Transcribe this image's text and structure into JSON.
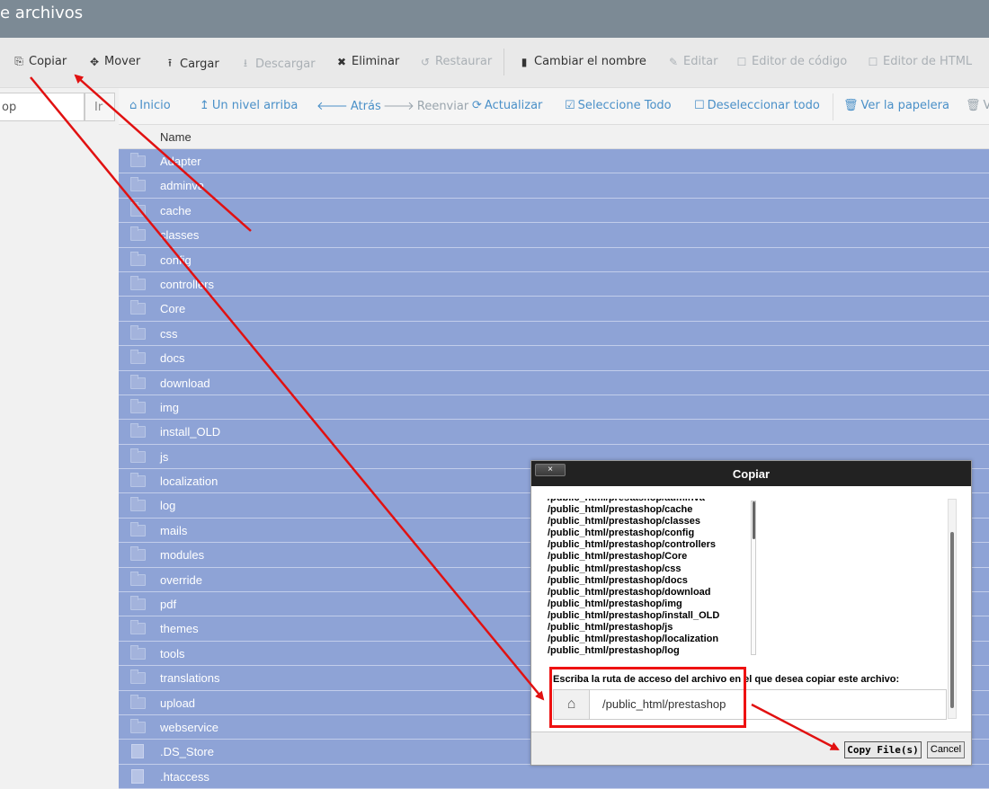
{
  "window": {
    "title": "e archivos"
  },
  "toolbar": {
    "items": [
      {
        "label": "Copiar",
        "icon": "copy-icon",
        "enabled": true
      },
      {
        "label": "Mover",
        "icon": "move-icon",
        "enabled": true
      },
      {
        "label": "Cargar",
        "icon": "upload-icon",
        "enabled": true
      },
      {
        "label": "Descargar",
        "icon": "download-icon",
        "enabled": false
      },
      {
        "label": "Eliminar",
        "icon": "delete-icon",
        "enabled": true
      },
      {
        "label": "Restaurar",
        "icon": "restore-icon",
        "enabled": false
      },
      {
        "label": "Cambiar el nombre",
        "icon": "file-icon",
        "enabled": true
      },
      {
        "label": "Editar",
        "icon": "pencil-icon",
        "enabled": false
      },
      {
        "label": "Editor de código",
        "icon": "edit-icon",
        "enabled": false
      },
      {
        "label": "Editor de HTML",
        "icon": "edit-icon",
        "enabled": false
      }
    ]
  },
  "left": {
    "path_value": "op",
    "go_label": "Ir"
  },
  "nav": {
    "items": [
      {
        "label": "Inicio",
        "icon": "home-icon",
        "enabled": true
      },
      {
        "label": "Un nivel arriba",
        "icon": "level-up-icon",
        "enabled": true
      },
      {
        "label": "Atrás",
        "icon": "arrow-left-icon",
        "enabled": true
      },
      {
        "label": "Reenviar",
        "icon": "arrow-right-icon",
        "enabled": false
      },
      {
        "label": "Actualizar",
        "icon": "refresh-icon",
        "enabled": true
      },
      {
        "label": "Seleccione Todo",
        "icon": "checkbox-checked-icon",
        "enabled": true
      },
      {
        "label": "Deseleccionar todo",
        "icon": "checkbox-empty-icon",
        "enabled": true
      },
      {
        "label": "Ver la papelera",
        "icon": "trash-icon",
        "enabled": true
      },
      {
        "label": "V",
        "icon": "trash-icon",
        "enabled": false
      }
    ]
  },
  "filelist": {
    "column_name": "Name",
    "rows": [
      {
        "name": "Adapter",
        "type": "folder"
      },
      {
        "name": "adminva",
        "type": "folder"
      },
      {
        "name": "cache",
        "type": "folder"
      },
      {
        "name": "classes",
        "type": "folder"
      },
      {
        "name": "config",
        "type": "folder"
      },
      {
        "name": "controllers",
        "type": "folder"
      },
      {
        "name": "Core",
        "type": "folder"
      },
      {
        "name": "css",
        "type": "folder"
      },
      {
        "name": "docs",
        "type": "folder"
      },
      {
        "name": "download",
        "type": "folder"
      },
      {
        "name": "img",
        "type": "folder"
      },
      {
        "name": "install_OLD",
        "type": "folder"
      },
      {
        "name": "js",
        "type": "folder"
      },
      {
        "name": "localization",
        "type": "folder"
      },
      {
        "name": "log",
        "type": "folder"
      },
      {
        "name": "mails",
        "type": "folder"
      },
      {
        "name": "modules",
        "type": "folder"
      },
      {
        "name": "override",
        "type": "folder"
      },
      {
        "name": "pdf",
        "type": "folder"
      },
      {
        "name": "themes",
        "type": "folder"
      },
      {
        "name": "tools",
        "type": "folder"
      },
      {
        "name": "translations",
        "type": "folder"
      },
      {
        "name": "upload",
        "type": "folder"
      },
      {
        "name": "webservice",
        "type": "folder"
      },
      {
        "name": ".DS_Store",
        "type": "file"
      },
      {
        "name": ".htaccess",
        "type": "file"
      }
    ]
  },
  "dialog": {
    "close_label": "×",
    "title": "Copiar",
    "paths": [
      "/public_html/prestashop/adminva",
      "/public_html/prestashop/cache",
      "/public_html/prestashop/classes",
      "/public_html/prestashop/config",
      "/public_html/prestashop/controllers",
      "/public_html/prestashop/Core",
      "/public_html/prestashop/css",
      "/public_html/prestashop/docs",
      "/public_html/prestashop/download",
      "/public_html/prestashop/img",
      "/public_html/prestashop/install_OLD",
      "/public_html/prestashop/js",
      "/public_html/prestashop/localization",
      "/public_html/prestashop/log"
    ],
    "prompt": "Escriba la ruta de acceso del archivo en el que desea copiar este archivo:",
    "destination_value": "/public_html/prestashop",
    "copy_button": "Copy File(s)",
    "cancel_button": "Cancel"
  },
  "colors": {
    "titlebar": "#7c8a95",
    "selected_row": "#8ea3d6",
    "nav_link": "#4a90c8",
    "annotation": "#e11111"
  }
}
